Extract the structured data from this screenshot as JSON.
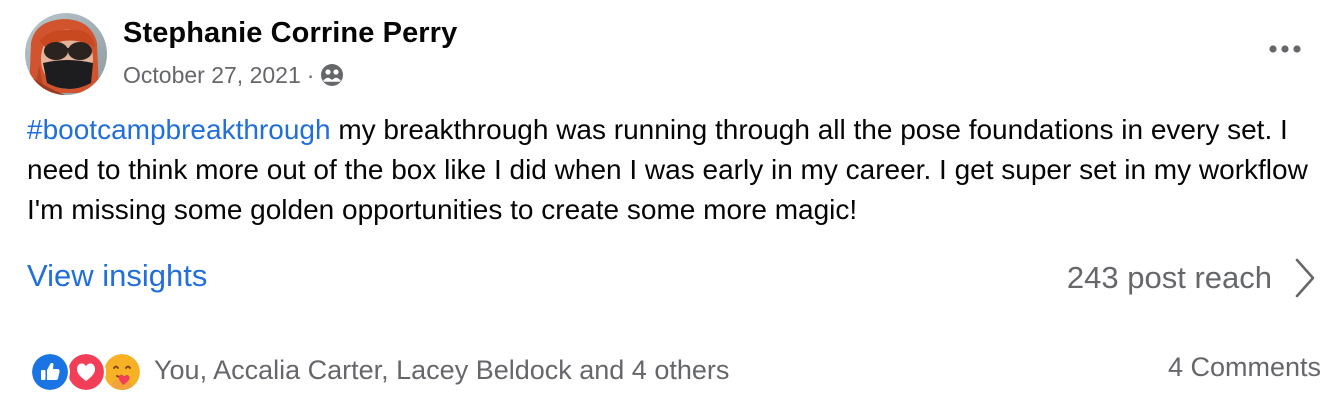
{
  "author": {
    "name": "Stephanie Corrine Perry",
    "date": "October 27, 2021",
    "separator": "·",
    "audience_icon": "friends-icon"
  },
  "post": {
    "hashtag": "#bootcampbreakthrough",
    "text": " my breakthrough was running through all the pose foundations in every set. I need to think more out of the box like I did when I was early in my career. I get super set in my workflow I'm missing some golden opportunities to create some more magic!"
  },
  "insights": {
    "link_label": "View insights",
    "reach_label": "243 post reach"
  },
  "footer": {
    "reactions": [
      "like",
      "love",
      "care"
    ],
    "reaction_names": "You, Accalia Carter, Lacey Beldock and 4 others",
    "comments": "4 Comments"
  },
  "colors": {
    "link_blue": "#216fdb",
    "secondary_text": "#65676b",
    "like_blue": "#1b74e4",
    "love_red": "#f33e58",
    "care_yellow": "#f7b125"
  }
}
